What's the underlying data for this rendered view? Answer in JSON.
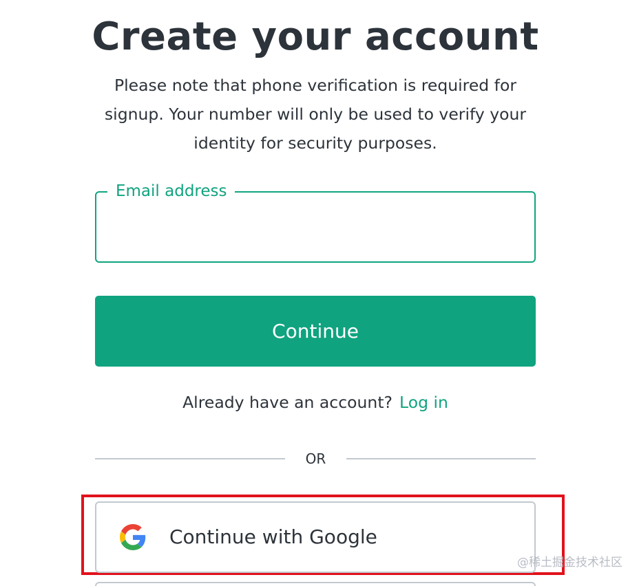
{
  "page": {
    "title": "Create your account",
    "subtitle": "Please note that phone verification is required for signup. Your number will only be used to verify your identity for security purposes."
  },
  "email": {
    "label": "Email address",
    "value": ""
  },
  "continue_button": {
    "label": "Continue"
  },
  "login": {
    "prompt": "Already have an account?",
    "link_label": "Log in"
  },
  "divider": {
    "label": "OR"
  },
  "google_button": {
    "label": "Continue with Google",
    "icon": "google-logo-icon"
  },
  "watermark": {
    "text": "@稀土掘金技术社区"
  },
  "colors": {
    "accent": "#10a37f",
    "text": "#2d333a",
    "border": "#c2c8d0",
    "highlight": "#e1121c"
  }
}
